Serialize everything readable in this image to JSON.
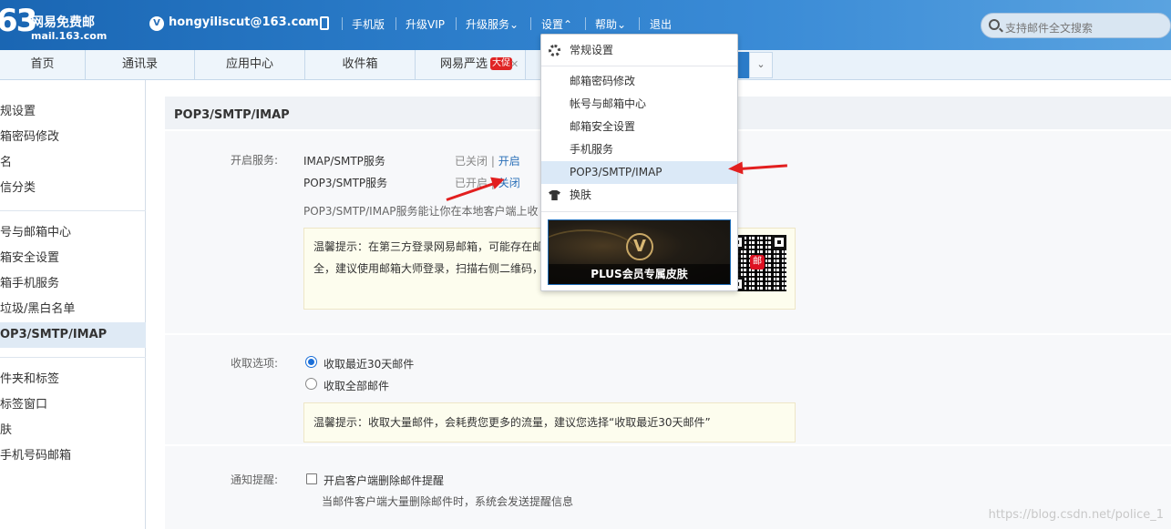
{
  "header": {
    "logo_num": "63",
    "logo_title": "网易免费邮",
    "logo_sub": "mail.163.com",
    "user_badge": "V",
    "user_email": "hongyiliscut@163.com",
    "nav": [
      "手机版",
      "升级VIP",
      "升级服务",
      "设置",
      "帮助",
      "退出"
    ],
    "search_placeholder": "支持邮件全文搜索"
  },
  "tabs": [
    {
      "label": "首页"
    },
    {
      "label": "通讯录"
    },
    {
      "label": "应用中心"
    },
    {
      "label": "收件箱"
    },
    {
      "label": "网易严选",
      "badge": "大促"
    }
  ],
  "sidebar": {
    "items": [
      "规设置",
      "箱密码修改",
      "名",
      "信分类",
      "号与邮箱中心",
      "箱安全设置",
      "箱手机服务",
      "垃圾/黑白名单",
      "OP3/SMTP/IMAP",
      "件夹和标签",
      "标签窗口",
      "肤",
      "手机号码邮箱"
    ]
  },
  "main": {
    "title": "POP3/SMTP/IMAP",
    "service_label": "开启服务:",
    "services": [
      {
        "name": "IMAP/SMTP服务",
        "status": "已关闭",
        "action": "开启"
      },
      {
        "name": "POP3/SMTP服务",
        "status": "已开启",
        "action": "关闭"
      }
    ],
    "desc": "POP3/SMTP/IMAP服务能让你在本地客户端上收",
    "tip1_line1": "温馨提示：在第三方登录网易邮箱，可能存在邮",
    "tip1_line2": "全，建议使用邮箱大师登录，扫描右侧二维码，",
    "qr_mark": "邮",
    "receive_label": "收取选项:",
    "receive_options": [
      "收取最近30天邮件",
      "收取全部邮件"
    ],
    "tip2": "温馨提示：收取大量邮件，会耗费您更多的流量，建议您选择“收取最近30天邮件”",
    "notify_label": "通知提醒:",
    "notify_option": "开启客户端删除邮件提醒",
    "notify_desc": "当邮件客户端大量删除邮件时，系统会发送提醒信息"
  },
  "dropdown": {
    "items": [
      "常规设置",
      "邮箱密码修改",
      "帐号与邮箱中心",
      "邮箱安全设置",
      "手机服务",
      "POP3/SMTP/IMAP",
      "换肤"
    ],
    "banner_v": "V",
    "banner_text": "PLUS会员专属皮肤"
  },
  "watermark": "https://blog.csdn.net/police_1",
  "colors": {
    "header_blue": "#2a7bc8",
    "highlight": "#dbe9f7",
    "arrow_red": "#e21f1f",
    "link": "#2a6fb8"
  }
}
